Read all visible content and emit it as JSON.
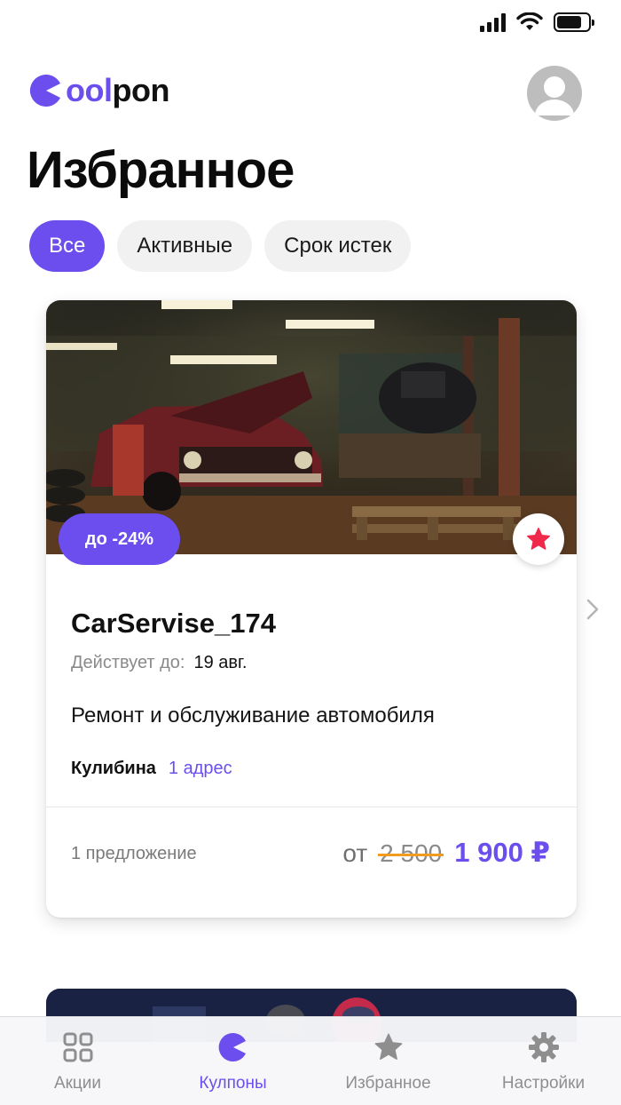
{
  "app": {
    "name_prefix": "c",
    "name_accent": "ool",
    "name_suffix": "pon",
    "accent_color": "#6b4eed"
  },
  "page": {
    "title": "Избранное"
  },
  "filters": [
    {
      "label": "Все",
      "active": true
    },
    {
      "label": "Активные",
      "active": false
    },
    {
      "label": "Срок истек",
      "active": false
    }
  ],
  "card": {
    "discount": "до -24%",
    "title": "CarServise_174",
    "valid_label": "Действует до:",
    "valid_date": "19 авг.",
    "description": "Ремонт и обслуживание автомобиля",
    "street": "Кулибина",
    "address_link": "1 адрес",
    "offers": "1 предложение",
    "price_from": "от",
    "price_old": "2 500",
    "price_new": "1 900 ₽",
    "favorite_icon": "star-icon",
    "favorite_color": "#f0284a"
  },
  "tabs": [
    {
      "label": "Акции",
      "icon": "grid-icon",
      "active": false
    },
    {
      "label": "Кулпоны",
      "icon": "coolpon-icon",
      "active": true
    },
    {
      "label": "Избранное",
      "icon": "star-icon",
      "active": false
    },
    {
      "label": "Настройки",
      "icon": "gear-icon",
      "active": false
    }
  ]
}
